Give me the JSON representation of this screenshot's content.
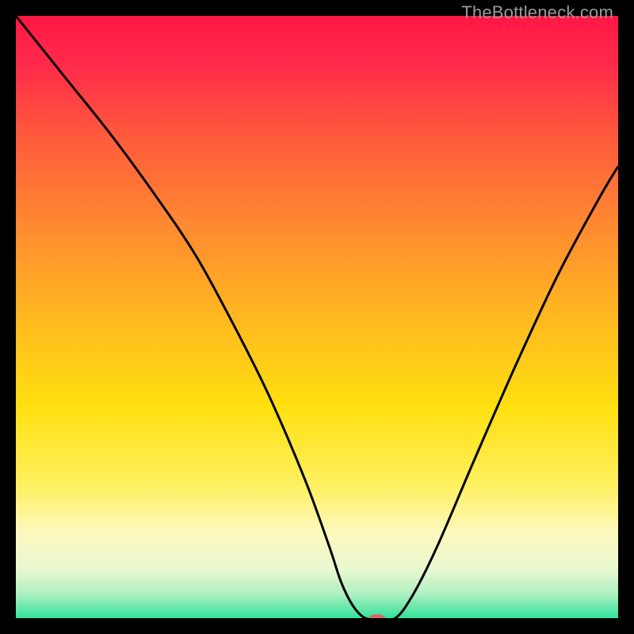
{
  "watermark": "TheBottleneck.com",
  "chart_data": {
    "type": "line",
    "title": "",
    "xlabel": "",
    "ylabel": "",
    "xlim": [
      0,
      100
    ],
    "ylim": [
      0,
      100
    ],
    "gradient_stops": [
      {
        "offset": 0,
        "color": "#ff1744"
      },
      {
        "offset": 0.08,
        "color": "#ff2a4a"
      },
      {
        "offset": 0.2,
        "color": "#ff5a3c"
      },
      {
        "offset": 0.35,
        "color": "#ff8a30"
      },
      {
        "offset": 0.5,
        "color": "#ffb820"
      },
      {
        "offset": 0.65,
        "color": "#ffe010"
      },
      {
        "offset": 0.78,
        "color": "#fff060"
      },
      {
        "offset": 0.86,
        "color": "#fcf9c0"
      },
      {
        "offset": 0.92,
        "color": "#e8f8d0"
      },
      {
        "offset": 0.96,
        "color": "#aef0c0"
      },
      {
        "offset": 1.0,
        "color": "#32e29a"
      }
    ],
    "series": [
      {
        "name": "bottleneck-curve",
        "x": [
          0,
          8,
          16,
          24,
          30,
          36,
          42,
          48,
          52,
          54,
          56,
          58,
          60,
          63,
          66,
          70,
          76,
          83,
          90,
          97,
          100
        ],
        "y": [
          100,
          90,
          80,
          69,
          60,
          49,
          37,
          23,
          12,
          6,
          2,
          0,
          0,
          0,
          4,
          12,
          26,
          42,
          57,
          70,
          75
        ]
      }
    ],
    "marker": {
      "x": 60,
      "y": 0,
      "rx": 10,
      "ry": 5,
      "color": "#d66a6a"
    }
  }
}
